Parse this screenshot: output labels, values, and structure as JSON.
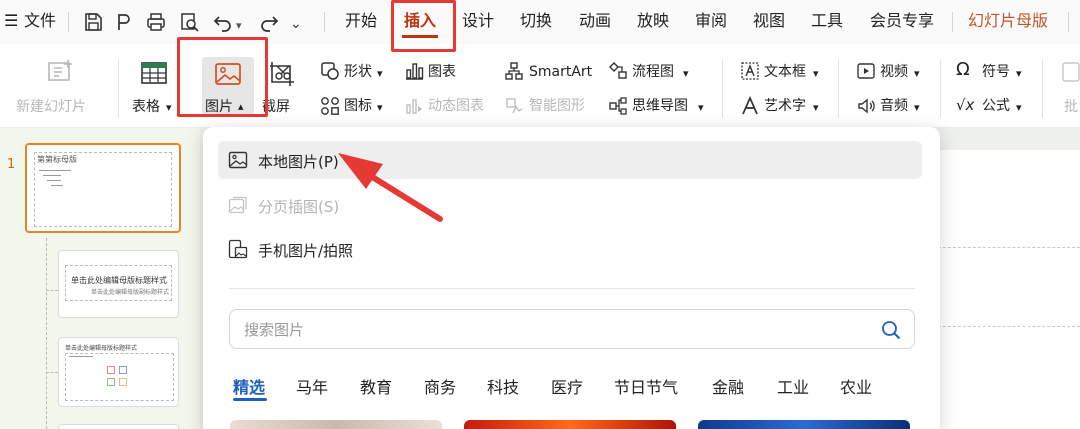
{
  "menubar": {
    "menu_icon": "hamburger-icon",
    "file_label": "文件",
    "tabs": [
      "开始",
      "插入",
      "设计",
      "切换",
      "动画",
      "放映",
      "审阅",
      "视图",
      "工具",
      "会员专享",
      "幻灯片母版"
    ],
    "active_tab": "插入",
    "accent_color": "#c0330f",
    "master_tab_color": "#c0582a"
  },
  "ribbon": {
    "new_slide": "新建幻灯片",
    "table": "表格",
    "picture": "图片",
    "screenshot": "截屏",
    "shape": "形状",
    "icon": "图标",
    "chart": "图表",
    "dynamic_chart": "动态图表",
    "smartart": "SmartArt",
    "smart_graphic": "智能图形",
    "flowchart": "流程图",
    "mindmap": "思维导图",
    "textbox": "文本框",
    "wordart": "艺术字",
    "video": "视频",
    "audio": "音频",
    "symbol": "符号",
    "formula": "公式",
    "comment_partial": "批"
  },
  "thumbnails": {
    "slide_number": "1",
    "thumb1_title": "第第标母版",
    "thumb2_title": "单击此处编辑母版标题样式",
    "thumb2_subtitle": "单击此处编辑母版副标题样式",
    "thumb3_title": "单击此处编辑母版标题样式"
  },
  "dropdown": {
    "items": [
      {
        "label": "本地图片(P)",
        "enabled": true,
        "icon": "image-icon"
      },
      {
        "label": "分页插图(S)",
        "enabled": false,
        "icon": "paged-image-icon"
      },
      {
        "label": "手机图片/拍照",
        "enabled": true,
        "icon": "phone-image-icon"
      }
    ],
    "search_placeholder": "搜索图片",
    "categories": [
      "精选",
      "马年",
      "教育",
      "商务",
      "科技",
      "医疗",
      "节日节气",
      "金融",
      "工业",
      "农业"
    ],
    "active_category": "精选",
    "category_accent": "#1f5fbf"
  },
  "annotations": {
    "highlight_color": "#e53935"
  }
}
